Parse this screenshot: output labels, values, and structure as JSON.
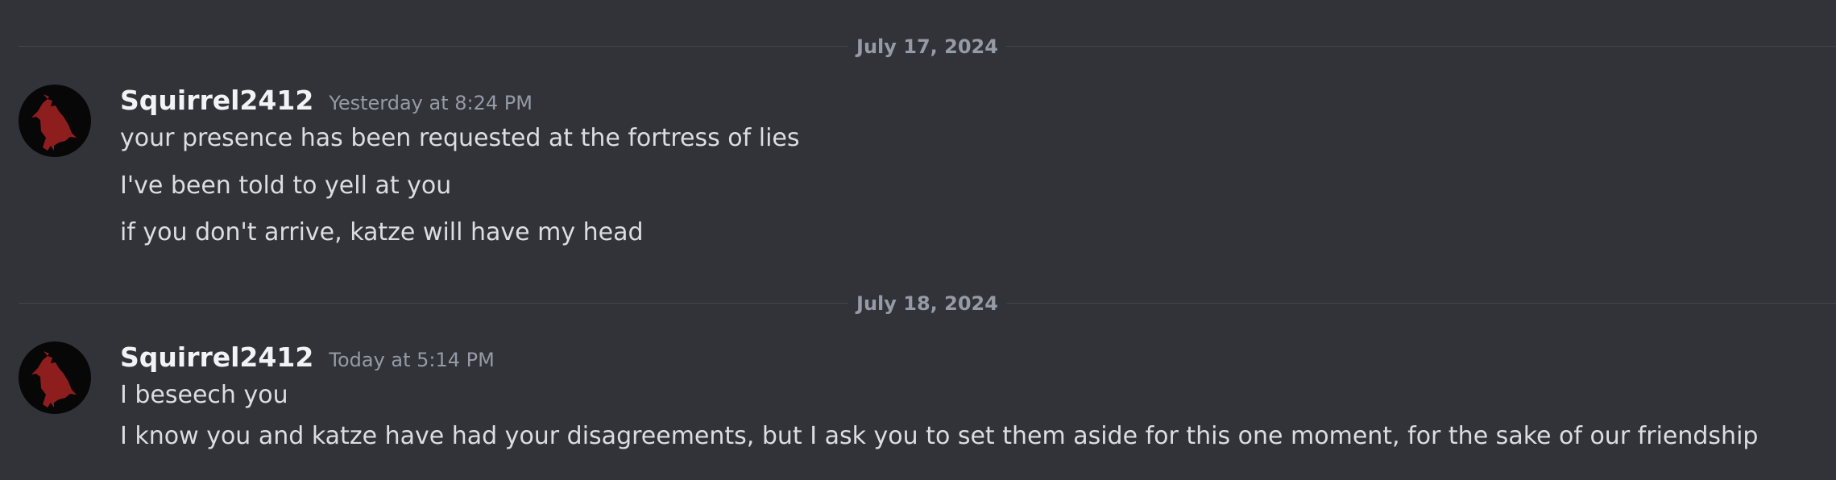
{
  "dividers": [
    {
      "date": "July 17, 2024"
    },
    {
      "date": "July 18, 2024"
    }
  ],
  "messages": [
    {
      "username": "Squirrel2412",
      "timestamp": "Yesterday at 8:24 PM",
      "lines": [
        "your presence has been requested at the fortress of lies",
        "I've been told to yell at you",
        "if you don't arrive, katze will have my head"
      ]
    },
    {
      "username": "Squirrel2412",
      "timestamp": "Today at 5:14 PM",
      "lines": [
        "I beseech you",
        "I know you and katze have had your disagreements, but I ask you to set them aside for this one moment, for the sake of our friendship"
      ]
    }
  ],
  "avatar": {
    "icon": "red-crow-avatar",
    "colors": {
      "bg": "#070708",
      "bird": "#8e1d1d"
    }
  }
}
